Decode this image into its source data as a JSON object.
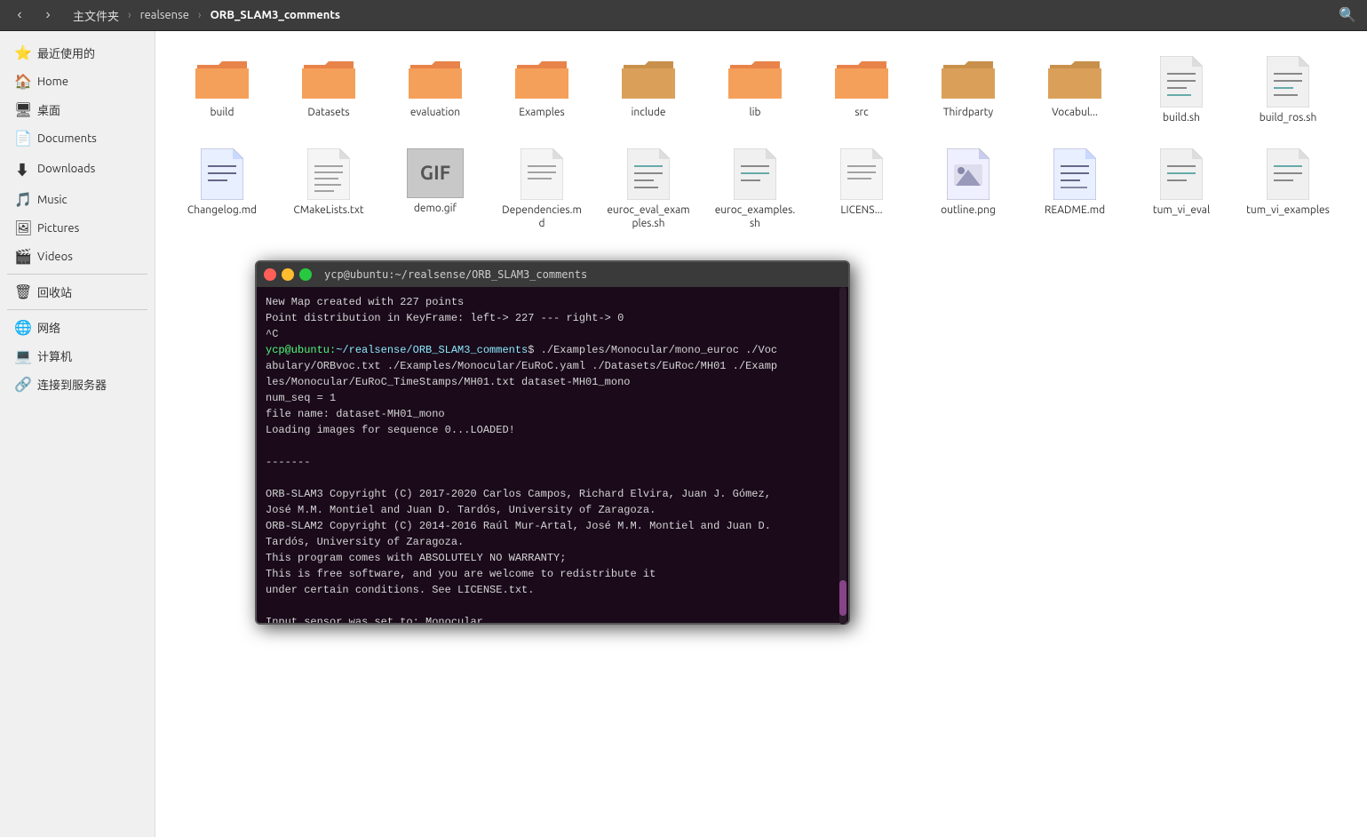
{
  "topbar": {
    "back_label": "‹",
    "forward_label": "›",
    "breadcrumb": [
      {
        "label": "主文件夹",
        "active": false
      },
      {
        "label": "realsense",
        "active": false
      },
      {
        "label": "ORB_SLAM3_comments",
        "active": true
      }
    ],
    "search_icon": "🔍"
  },
  "sidebar": {
    "items": [
      {
        "icon": "⭐",
        "label": "最近使用的"
      },
      {
        "icon": "🏠",
        "label": "Home"
      },
      {
        "icon": "🖥",
        "label": "桌面"
      },
      {
        "icon": "📄",
        "label": "Documents"
      },
      {
        "icon": "⬇",
        "label": "Downloads"
      },
      {
        "icon": "🎵",
        "label": "Music"
      },
      {
        "icon": "🖼",
        "label": "Pictures"
      },
      {
        "icon": "🎬",
        "label": "Videos"
      },
      {
        "icon": "🗑",
        "label": "回收站"
      },
      {
        "icon": "🌐",
        "label": "网络"
      },
      {
        "icon": "💻",
        "label": "计算机"
      },
      {
        "icon": "🔗",
        "label": "连接到服务器"
      }
    ]
  },
  "files": {
    "folders": [
      {
        "name": "build"
      },
      {
        "name": "Datasets"
      },
      {
        "name": "evaluation"
      },
      {
        "name": "Examples"
      },
      {
        "name": "include"
      },
      {
        "name": "lib"
      },
      {
        "name": "src"
      },
      {
        "name": "Thirdparty"
      },
      {
        "name": "Vocabul..."
      }
    ],
    "files": [
      {
        "name": "build.sh",
        "type": "script"
      },
      {
        "name": "build_ros.sh",
        "type": "script"
      },
      {
        "name": "Changelog.md",
        "type": "md"
      },
      {
        "name": "CMakeLists.txt",
        "type": "text"
      },
      {
        "name": "demo.gif",
        "type": "gif"
      },
      {
        "name": "Dependencies.md",
        "type": "md"
      },
      {
        "name": "euroc_eval_examples.sh",
        "type": "script"
      },
      {
        "name": "euroc_examples.sh",
        "type": "script"
      },
      {
        "name": "LICENS...",
        "type": "text"
      },
      {
        "name": "outline.png",
        "type": "image"
      },
      {
        "name": "README.md",
        "type": "md"
      },
      {
        "name": "tum_vi_eval",
        "type": "script"
      },
      {
        "name": "tum_vi_examples",
        "type": "script"
      }
    ]
  },
  "terminal": {
    "title": "ycp@ubuntu:~/realsense/ORB_SLAM3_comments",
    "content": "New Map created with 227 points\nPoint distribution in KeyFrame: left-> 227 --- right-> 0\n^C\nycp@ubuntu:~/realsense/ORB_SLAM3_comments$ ./Examples/Monocular/mono_euroc ./Vocabulary/ORBvoc.txt ./Examples/Monocular/EuRoC.yaml ./Datasets/EuRoc/MH01 ./Examples/Monocular/EuRoC_TimeStamps/MH01.txt dataset-MH01_mono\nnum_seq = 1\nfile name: dataset-MH01_mono\nLoading images for sequence 0...LOADED!\n\n-------\n\nORB-SLAM3 Copyright (C) 2017-2020 Carlos Campos, Richard Elvira, Juan J. Gómez,\nJosé M.M. Montiel and Juan D. Tardós, University of Zaragoza.\nORB-SLAM2 Copyright (C) 2014-2016 Raúl Mur-Artal, José M.M. Montiel and Juan D.\nTardós, University of Zaragoza.\nThis program comes with ABSOLUTELY NO WARRANTY;\nThis is free software, and you are welcome to redistribute it\nunder certain conditions. See LICENSE.txt.\n\nInput sensor was set to: Monocular\n\nLoading ORB Vocabulary. This could take a while..."
  }
}
